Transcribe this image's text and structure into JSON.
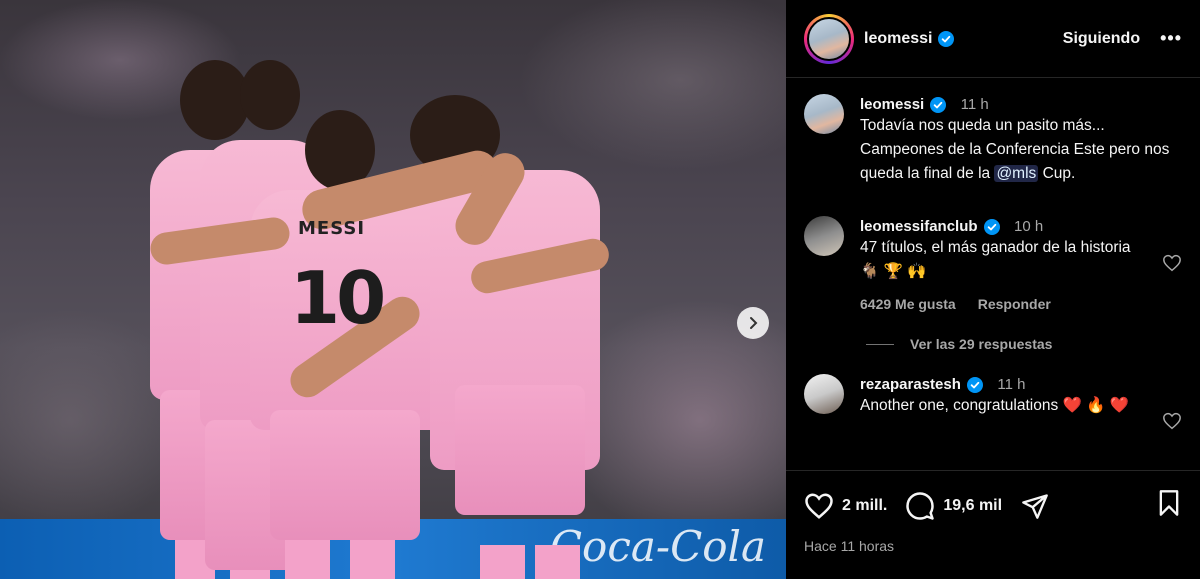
{
  "post": {
    "username": "leomessi",
    "follow_label": "Siguiendo",
    "more_label": "•••",
    "jersey_name": "MESSI",
    "jersey_number": "10",
    "banner_text": "Coca-Cola"
  },
  "caption": {
    "username": "leomessi",
    "time": "11 h",
    "text_before": "Todavía nos queda un pasito más... Campeones de la Conferencia Este pero nos queda la final de la ",
    "mention": "@mls",
    "text_after": " Cup."
  },
  "comments": [
    {
      "username": "leomessifanclub",
      "time": "10 h",
      "text": "47 títulos, el más ganador de la historia 🐐 🏆 🙌",
      "likes": "6429 Me gusta",
      "reply_label": "Responder",
      "replies_label": "Ver las 29 respuestas"
    },
    {
      "username": "rezaparastesh",
      "time": "11 h",
      "text": "Another one, congratulations ❤️ 🔥 ❤️"
    }
  ],
  "actions": {
    "likes_count": "2 mill.",
    "comments_count": "19,6 mil",
    "timestamp": "Hace 11 horas"
  },
  "icons": {
    "verified": "verified-badge-icon",
    "like": "heart-icon",
    "comment": "comment-bubble-icon",
    "share": "paper-plane-icon",
    "save": "bookmark-icon",
    "next": "chevron-right-icon"
  },
  "colors": {
    "background": "#000000",
    "verified_blue": "#0095f6",
    "text_primary": "#f5f5f5",
    "text_secondary": "#a8a8a8",
    "jersey_pink": "#f7b9d4"
  }
}
